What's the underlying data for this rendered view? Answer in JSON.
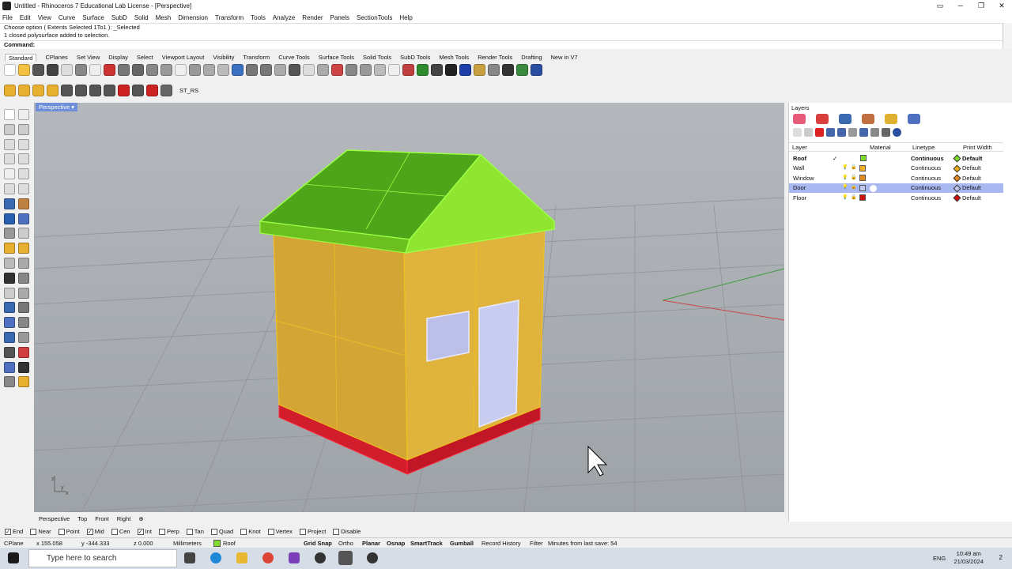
{
  "window": {
    "title": "Untitled - Rhinoceros 7 Educational Lab License - [Perspective]",
    "controls": [
      "▭",
      "─",
      "❐",
      "✕"
    ]
  },
  "menu": [
    "File",
    "Edit",
    "View",
    "Curve",
    "Surface",
    "SubD",
    "Solid",
    "Mesh",
    "Dimension",
    "Transform",
    "Tools",
    "Analyze",
    "Render",
    "Panels",
    "SectionTools",
    "Help"
  ],
  "command": {
    "history1": "Choose option ( Extents  Selected  1To1 ): _Selected",
    "history2": "1 closed polysurface added to selection.",
    "prompt": "Command:"
  },
  "toolbar_tabs": [
    "Standard",
    "CPlanes",
    "Set View",
    "Display",
    "Select",
    "Viewport Layout",
    "Visibility",
    "Transform",
    "Curve Tools",
    "Surface Tools",
    "Solid Tools",
    "SubD Tools",
    "Mesh Tools",
    "Render Tools",
    "Drafting",
    "New in V7"
  ],
  "toolbar2_label": "ST_RS",
  "viewport": {
    "title": "Perspective",
    "tabs": [
      "Perspective",
      "Top",
      "Front",
      "Right"
    ],
    "axis_labels": {
      "z": "z",
      "y": "y",
      "x": "x"
    }
  },
  "layers_panel": {
    "title": "Layers",
    "columns": {
      "layer": "Layer",
      "material": "Material",
      "linetype": "Linetype",
      "print_width": "Print Width"
    },
    "rows": [
      {
        "name": "Roof",
        "current": "✓",
        "color": "#7ddc2c",
        "linetype": "Continuous",
        "print_width": "Default",
        "bold": true
      },
      {
        "name": "Wall",
        "current": "",
        "color": "#f0b020",
        "linetype": "Continuous",
        "print_width": "Default",
        "bold": false
      },
      {
        "name": "Window",
        "current": "",
        "color": "#e08a20",
        "linetype": "Continuous",
        "print_width": "Default",
        "bold": false
      },
      {
        "name": "Door",
        "current": "",
        "color": "#c0c8f0",
        "linetype": "Continuous",
        "print_width": "Default",
        "bold": false,
        "selected": true
      },
      {
        "name": "Floor",
        "current": "",
        "color": "#cc1010",
        "linetype": "Continuous",
        "print_width": "Default",
        "bold": false
      }
    ]
  },
  "osnaps": [
    {
      "label": "End",
      "checked": true
    },
    {
      "label": "Near",
      "checked": false
    },
    {
      "label": "Point",
      "checked": false
    },
    {
      "label": "Mid",
      "checked": true
    },
    {
      "label": "Cen",
      "checked": false
    },
    {
      "label": "Int",
      "checked": true
    },
    {
      "label": "Perp",
      "checked": false
    },
    {
      "label": "Tan",
      "checked": false
    },
    {
      "label": "Quad",
      "checked": false
    },
    {
      "label": "Knot",
      "checked": false
    },
    {
      "label": "Vertex",
      "checked": false
    },
    {
      "label": "Project",
      "checked": false
    },
    {
      "label": "Disable",
      "checked": false
    }
  ],
  "status": {
    "cplane": "CPlane",
    "x": "x 155.058",
    "y": "y -344.333",
    "z": "z 0.000",
    "units": "Millimeters",
    "layer": "Roof",
    "grid_snap": "Grid Snap",
    "ortho": "Ortho",
    "planar": "Planar",
    "osnap": "Osnap",
    "smarttrack": "SmartTrack",
    "gumball": "Gumball",
    "record_history": "Record History",
    "filter": "Filter",
    "last_save": "Minutes from last save: 54"
  },
  "taskbar": {
    "search_placeholder": "Type here to search",
    "lang": "ENG",
    "time": "10:49 am",
    "date": "21/03/2024",
    "notifications": "2"
  }
}
